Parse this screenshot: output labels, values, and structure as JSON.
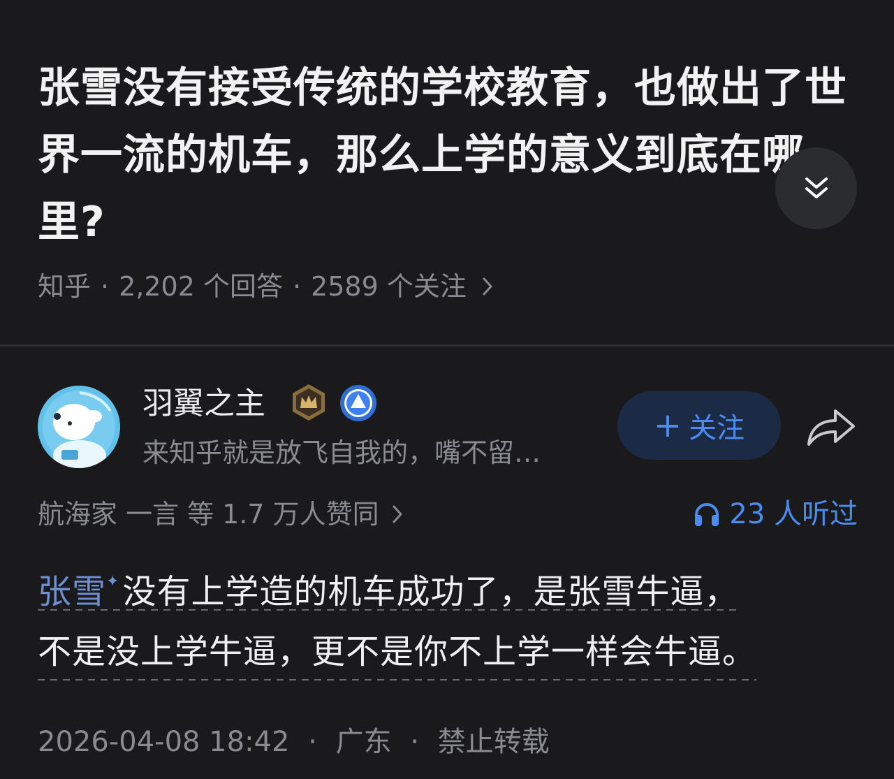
{
  "question": {
    "title": "张雪没有接受传统的学校教育，也做出了世界一流的机车，那么上学的意义到底在哪里?",
    "source": "知乎",
    "answers_count": "2,202 个回答",
    "followers_count": "2589 个关注",
    "expand_icon": "double-chevron-down-icon"
  },
  "author": {
    "name": "羽翼之主",
    "bio": "来知乎就是放飞自我的，嘴不留…",
    "follow_label": "关注",
    "badges": [
      "crown-badge-icon",
      "verified-badge-icon"
    ]
  },
  "answer": {
    "upvoters": "航海家 一言",
    "upvote_text": "等 1.7 万人赞同",
    "listen_count": "23 人听过",
    "link_text": "张雪",
    "line1_rest": "没有上学造的机车成功了，是张雪牛逼，",
    "line2": "不是没上学牛逼，更不是你不上学一样会牛逼。",
    "date": "2026-04-08 18:42",
    "location": "广东",
    "copyright": "禁止转载"
  },
  "colors": {
    "background": "#1a1a1d",
    "accent": "#4a8cf2",
    "muted": "#8a8b91",
    "link": "#6f8fcf"
  }
}
